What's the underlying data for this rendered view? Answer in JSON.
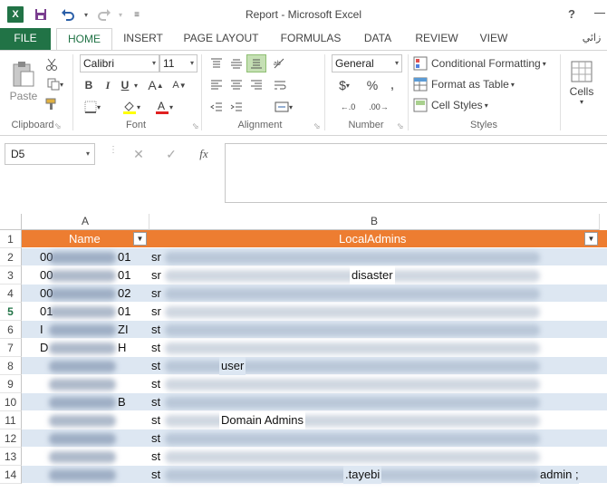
{
  "window": {
    "title": "Report - Microsoft Excel",
    "help": "?",
    "rtl_text": "زائي"
  },
  "tabs": [
    "FILE",
    "HOME",
    "INSERT",
    "PAGE LAYOUT",
    "FORMULAS",
    "DATA",
    "REVIEW",
    "VIEW"
  ],
  "ribbon": {
    "clipboard": {
      "label": "Clipboard",
      "paste": "Paste"
    },
    "font": {
      "label": "Font",
      "name": "Calibri",
      "size": "11",
      "bold": "B",
      "italic": "I",
      "underline": "U"
    },
    "alignment": {
      "label": "Alignment"
    },
    "number": {
      "label": "Number",
      "format": "General",
      "currency": "$",
      "percent": "%",
      "comma": ","
    },
    "styles": {
      "label": "Styles",
      "conditional": "Conditional Formatting",
      "table": "Format as Table",
      "cell_styles": "Cell Styles"
    },
    "cells": {
      "label": "Cells"
    }
  },
  "formula_bar": {
    "name_box": "D5",
    "fx": "fx",
    "formula": ""
  },
  "sheet": {
    "columns": [
      "A",
      "B"
    ],
    "header": {
      "col_a": "Name",
      "col_b": "LocalAdmins"
    },
    "rows": [
      {
        "num": "2",
        "a": "01",
        "a_pre": "00",
        "b_pre": "sr",
        "b_vis": "disaster",
        "b_vis_show": false
      },
      {
        "num": "3",
        "a": "01",
        "a_pre": "00",
        "b_pre": "sr",
        "b_vis": "disaster"
      },
      {
        "num": "4",
        "a": "02",
        "a_pre": "00",
        "b_pre": "sr",
        "b_vis": ""
      },
      {
        "num": "5",
        "a": "01",
        "a_pre": "01",
        "b_pre": "sr",
        "b_vis": ""
      },
      {
        "num": "6",
        "a": "ZI",
        "a_pre": "I",
        "b_pre": "st",
        "b_vis": ""
      },
      {
        "num": "7",
        "a": "H",
        "a_pre": "D",
        "b_pre": "st",
        "b_vis": ""
      },
      {
        "num": "8",
        "a": "",
        "a_pre": "",
        "b_pre": "st",
        "b_vis": "user"
      },
      {
        "num": "9",
        "a": "",
        "a_pre": "",
        "b_pre": "st",
        "b_vis": ""
      },
      {
        "num": "10",
        "a": "B",
        "a_pre": "",
        "b_pre": "st",
        "b_vis": ""
      },
      {
        "num": "11",
        "a": "",
        "a_pre": "",
        "b_pre": "st",
        "b_vis": "Domain Admins"
      },
      {
        "num": "12",
        "a": "",
        "a_pre": "",
        "b_pre": "st",
        "b_vis": ""
      },
      {
        "num": "13",
        "a": "",
        "a_pre": "",
        "b_pre": "st",
        "b_vis": ""
      },
      {
        "num": "14",
        "a": "",
        "a_pre": "",
        "b_pre": "st",
        "b_vis": ".tayebi",
        "b_vis2": "admin ;"
      }
    ],
    "active_row": "5"
  },
  "colors": {
    "accent": "#217346",
    "header_fill": "#ed7d31",
    "band": "#dde7f2"
  }
}
